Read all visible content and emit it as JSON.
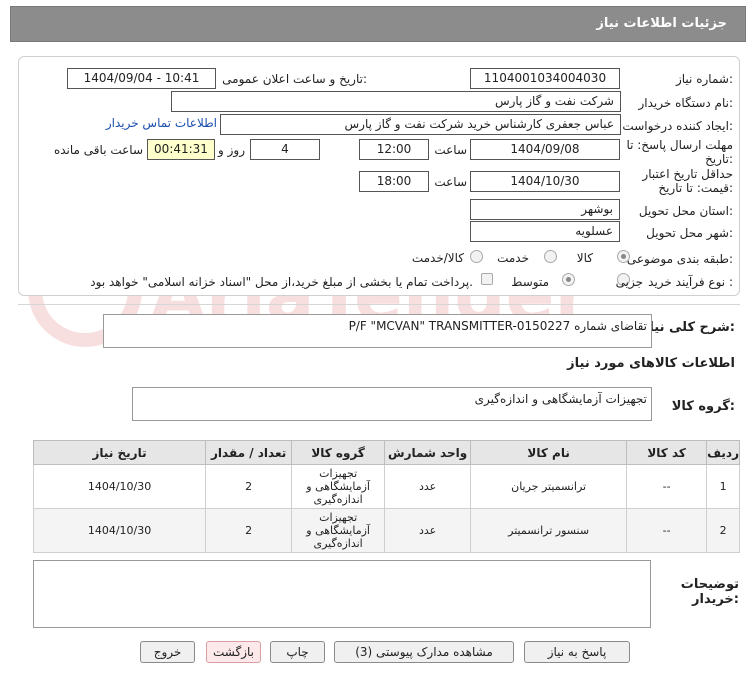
{
  "header": {
    "title": "جزئیات اطلاعات نیاز"
  },
  "form": {
    "need_number_label": "شماره نیاز:",
    "need_number": "1104001034004030",
    "announce_label": "تاریخ و ساعت اعلان عمومی:",
    "announce_value": "1404/09/04 - 10:41",
    "buyer_org_label": "نام دستگاه خریدار:",
    "buyer_org": "شرکت نفت و گاز پارس",
    "creator_label": "ایجاد کننده درخواست:",
    "creator": "عباس  جعفری کارشناس خرید  شرکت نفت و گاز پارس",
    "contact_link": "اطلاعات تماس خریدار",
    "deadline_label_1": "مهلت ارسال پاسخ: تا",
    "deadline_label_2": "تاریخ:",
    "deadline_date": "1404/09/08",
    "time_label": "ساعت",
    "deadline_time": "12:00",
    "days_value": "4",
    "days_label": "روز و",
    "remaining_time": "00:41:31",
    "remaining_label": "ساعت باقی مانده",
    "validity_label_1": "حداقل تاریخ اعتبار",
    "validity_label_2": "قیمت: تا تاریخ:",
    "validity_date": "1404/10/30",
    "validity_time": "18:00",
    "province_label": "استان محل تحویل:",
    "province": "بوشهر",
    "city_label": "شهر محل تحویل:",
    "city": "عسلویه",
    "category_label": "طبقه بندی موضوعی:",
    "category_options": [
      "کالا",
      "خدمت",
      "کالا/خدمت"
    ],
    "process_label": "نوع فرآیند خرید :",
    "process_options": [
      "جزیی",
      "متوسط"
    ],
    "payment_note": "پرداخت تمام یا بخشی از مبلغ خرید،از محل \"اسناد خزانه اسلامی\" خواهد بود."
  },
  "description": {
    "label": "شرح کلی نیاز:",
    "value": "P/F \"MCVAN\" TRANSMITTER-تقاضای شماره 0150227"
  },
  "goods_info_title": "اطلاعات کالاهای مورد نیاز",
  "goods_group": {
    "label": "گروه کالا:",
    "value": "تجهیزات آزمایشگاهی و اندازه‌گیری"
  },
  "table": {
    "headers": [
      "ردیف",
      "کد کالا",
      "نام کالا",
      "واحد شمارش",
      "گروه کالا",
      "تعداد / مقدار",
      "تاریخ نیاز"
    ],
    "rows": [
      [
        "1",
        "--",
        "ترانسمیتر جریان",
        "عدد",
        "تجهیزات آزمایشگاهی و اندازه‌گیری",
        "2",
        "1404/10/30"
      ],
      [
        "2",
        "--",
        "سنسور ترانسمیتر",
        "عدد",
        "تجهیزات آزمایشگاهی و اندازه‌گیری",
        "2",
        "1404/10/30"
      ]
    ]
  },
  "buyer_notes": {
    "label_1": "توضیحات",
    "label_2": "خریدار:",
    "value": ""
  },
  "buttons": {
    "reply": "پاسخ به نیاز",
    "attachments": "مشاهده مدارک پیوستی (3)",
    "print": "چاپ",
    "back": "بازگشت",
    "exit": "خروج"
  },
  "watermark": {
    "text": "AriaTender.net"
  },
  "colors": {
    "title_bar": "#8c8c8c",
    "link": "#1a4fb0",
    "remaining_bg": "#ffffcc"
  }
}
